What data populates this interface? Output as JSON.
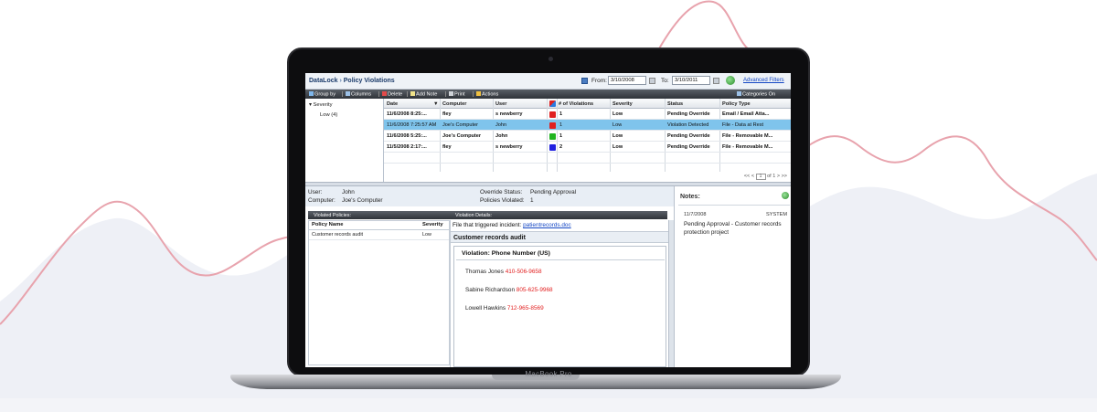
{
  "app": {
    "title_product": "DataLock",
    "title_separator": "›",
    "title_page": "Policy Violations",
    "from_label": "From:",
    "from_value": "3/10/2008",
    "to_label": "To:",
    "to_value": "3/10/2011",
    "advanced_filters": "Advanced Filters"
  },
  "toolbar": {
    "group_by": "Group by",
    "columns": "Columns",
    "delete": "Delete",
    "add_note": "Add Note",
    "print": "Print",
    "actions": "Actions",
    "categories": "Categories On"
  },
  "tree": {
    "severity": "Severity",
    "low": "Low (4)"
  },
  "grid": {
    "headers": [
      "Date",
      "Computer",
      "User",
      "# of Violations",
      "Severity",
      "Status",
      "Policy Type"
    ],
    "rows": [
      {
        "date": "11/6/2008 8:25:...",
        "computer": "fley",
        "user": "s newberry",
        "violations": "1",
        "severity": "Low",
        "status": "Pending Override",
        "policy": "Email / Email Atta...",
        "color": "#e02020"
      },
      {
        "date": "11/6/2008 7:25:57 AM",
        "computer": "Joe's Computer",
        "user": "John",
        "violations": "1",
        "severity": "Low",
        "status": "Violation Detected",
        "policy": "File - Data at Rest",
        "color": "#e02020"
      },
      {
        "date": "11/6/2008 5:25:...",
        "computer": "Joe's Computer",
        "user": "John",
        "violations": "1",
        "severity": "Low",
        "status": "Pending Override",
        "policy": "File - Removable M...",
        "color": "#1fb41f"
      },
      {
        "date": "11/5/2008 2:17:...",
        "computer": "fley",
        "user": "s newberry",
        "violations": "2",
        "severity": "Low",
        "status": "Pending Override",
        "policy": "File - Removable M...",
        "color": "#2020e0"
      }
    ],
    "pager_first": "<<",
    "pager_prev": "<",
    "pager_page": "1",
    "pager_of": "of 1",
    "pager_next": ">",
    "pager_last": ">>"
  },
  "details": {
    "user_label": "User:",
    "user_value": "John",
    "computer_label": "Computer:",
    "computer_value": "Joe's Computer",
    "override_label": "Override Status:",
    "override_value": "Pending Approval",
    "violated_label": "Policies Violated:",
    "violated_value": "1",
    "violated_policies_header": "Violated Policies:",
    "policy_name_header": "Policy Name",
    "severity_header": "Severity",
    "policy_name": "Customer records audit",
    "policy_severity": "Low",
    "violation_details_header": "Violation Details:",
    "file_label": "File that triggered incident:",
    "file_link": "patientrecords.doc",
    "section_title": "Customer records audit",
    "violation_type": "Violation: Phone Number (US)",
    "pii": [
      {
        "name": "Thomas Jones",
        "number": "410-506-9658"
      },
      {
        "name": "Sabine Richardson",
        "number": "805-625-9968"
      },
      {
        "name": "Lowell Hawkins",
        "number": "712-965-8569"
      }
    ]
  },
  "notes": {
    "title": "Notes:",
    "date": "11/7/2008",
    "author": "SYSTEM",
    "text": "Pending Approval - Customer records protection project"
  },
  "laptop": {
    "brand": "MacBook Pro"
  },
  "colors": {
    "accent_line": "#e8a3ad",
    "mountain": "#eef0f6",
    "selected_row": "#7fc4ec",
    "pii_number": "#e21f1f"
  }
}
